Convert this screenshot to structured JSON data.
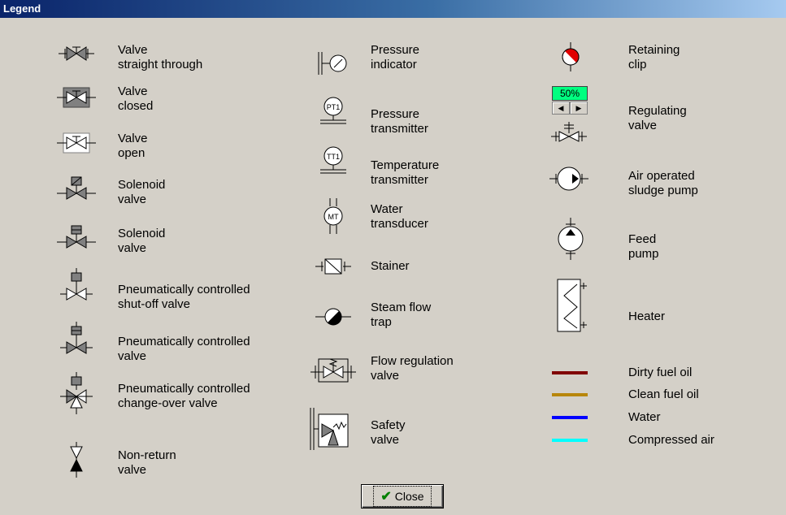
{
  "window": {
    "title": "Legend"
  },
  "column1": [
    {
      "lines": [
        "Valve",
        "straight through"
      ],
      "icon": "valve-straight-through-icon"
    },
    {
      "lines": [
        "Valve",
        "closed"
      ],
      "icon": "valve-closed-icon"
    },
    {
      "lines": [
        "Valve",
        "open"
      ],
      "icon": "valve-open-icon"
    },
    {
      "lines": [
        "Solenoid",
        "valve"
      ],
      "icon": "solenoid-valve-icon"
    },
    {
      "lines": [
        "Solenoid",
        "valve"
      ],
      "icon": "solenoid-valve-2-icon"
    },
    {
      "lines": [
        "Pneumatically controlled",
        "shut-off valve"
      ],
      "icon": "pneumatic-shutoff-valve-icon"
    },
    {
      "lines": [
        "Pneumatically controlled",
        "valve"
      ],
      "icon": "pneumatic-valve-icon"
    },
    {
      "lines": [
        "Pneumatically controlled",
        "change-over valve"
      ],
      "icon": "pneumatic-changeover-valve-icon"
    },
    {
      "lines": [
        "Non-return",
        "valve"
      ],
      "icon": "non-return-valve-icon"
    }
  ],
  "column2": [
    {
      "lines": [
        "Pressure",
        "indicator"
      ],
      "icon": "pressure-indicator-icon"
    },
    {
      "lines": [
        "Pressure",
        "transmitter"
      ],
      "icon": "pressure-transmitter-icon",
      "tag": "PT1"
    },
    {
      "lines": [
        "Temperature",
        "transmitter"
      ],
      "icon": "temperature-transmitter-icon",
      "tag": "TT1"
    },
    {
      "lines": [
        "Water",
        "transducer"
      ],
      "icon": "water-transducer-icon",
      "tag": "MT"
    },
    {
      "lines": [
        "Stainer"
      ],
      "icon": "strainer-icon"
    },
    {
      "lines": [
        "Steam flow",
        "trap"
      ],
      "icon": "steam-trap-icon"
    },
    {
      "lines": [
        "Flow regulation",
        "valve"
      ],
      "icon": "flow-regulation-valve-icon"
    },
    {
      "lines": [
        "Safety",
        "valve"
      ],
      "icon": "safety-valve-icon"
    }
  ],
  "column3": [
    {
      "lines": [
        "Retaining",
        "clip"
      ],
      "icon": "retaining-clip-icon"
    },
    {
      "lines": [
        "Regulating",
        "valve"
      ],
      "icon": "regulating-valve-icon",
      "percent": "50%"
    },
    {
      "lines": [
        "Air operated",
        "sludge pump"
      ],
      "icon": "air-operated-pump-icon"
    },
    {
      "lines": [
        "Feed",
        "pump"
      ],
      "icon": "feed-pump-icon"
    },
    {
      "lines": [
        "Heater"
      ],
      "icon": "heater-icon"
    }
  ],
  "lines_legend": [
    {
      "label": "Dirty fuel oil",
      "color": "#800000"
    },
    {
      "label": "Clean fuel oil",
      "color": "#b8860b"
    },
    {
      "label": "Water",
      "color": "#0000ff"
    },
    {
      "label": "Compressed air",
      "color": "#00ffff"
    }
  ],
  "close_button": {
    "label": "Close"
  }
}
